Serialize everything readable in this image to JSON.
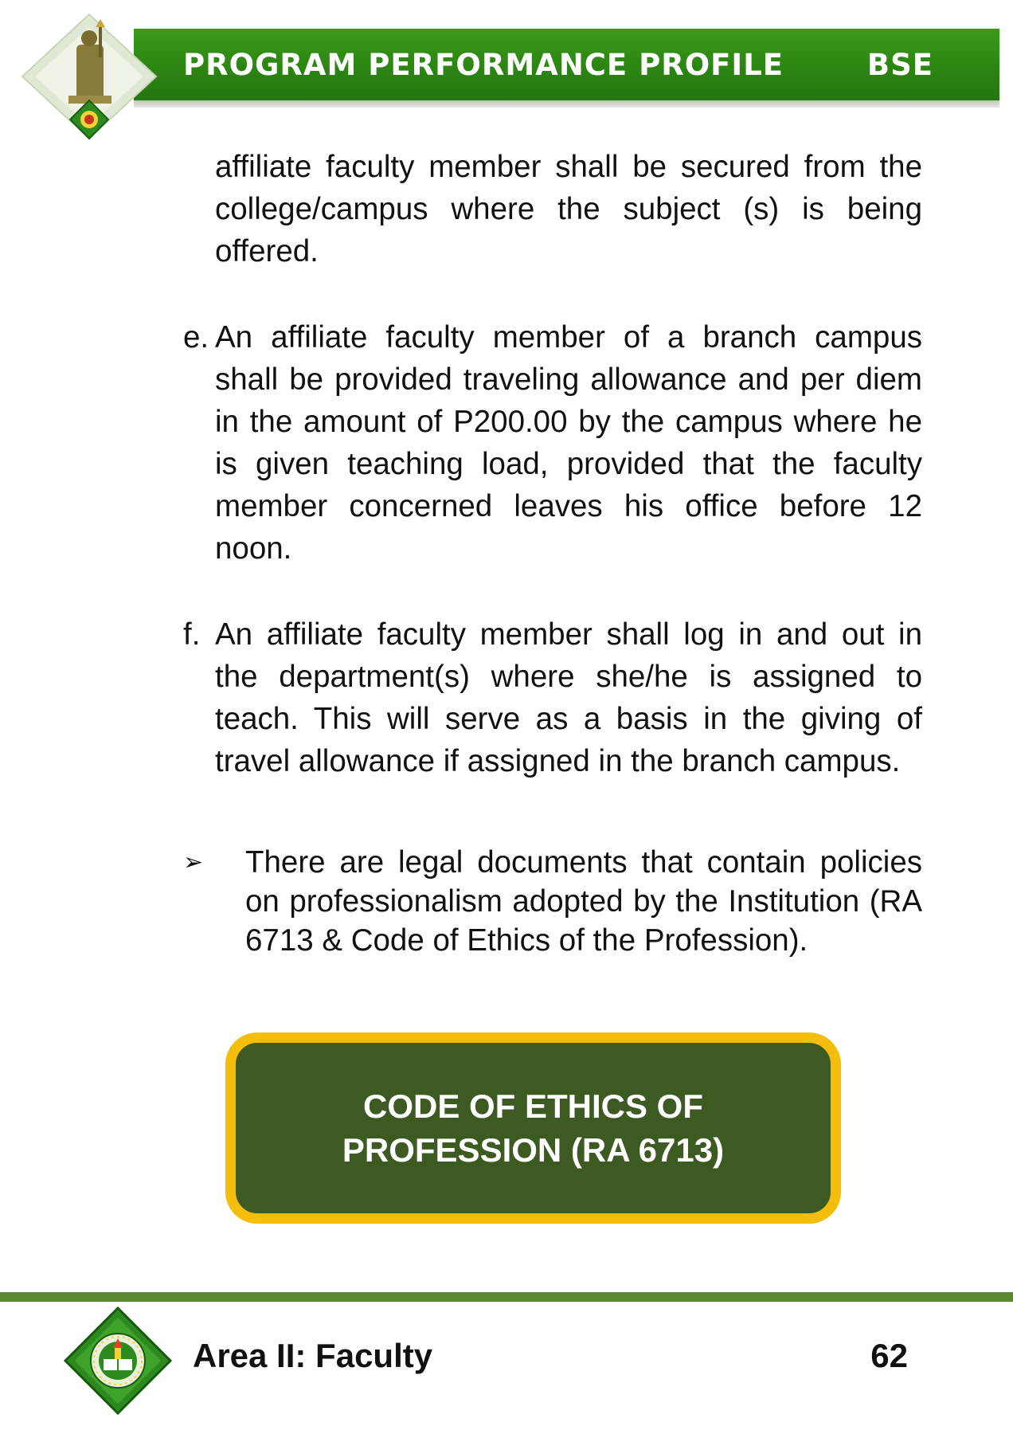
{
  "header": {
    "title": "PROGRAM PERFORMANCE PROFILE",
    "program_code": "BSE"
  },
  "content": {
    "continuation": "affiliate faculty member shall be secured from the college/campus where the subject (s) is being offered.",
    "items": [
      {
        "marker": "e.",
        "text": "An affiliate faculty member of a branch campus shall be provided traveling allowance and per diem in the amount of P200.00 by the campus where he is given teaching load, provided that the faculty member concerned leaves his office before 12 noon."
      },
      {
        "marker": "f.",
        "text": "An affiliate faculty member shall log in and out in the department(s) where she/he is assigned to teach. This will serve as a basis in the giving of travel allowance if assigned in the branch campus."
      }
    ],
    "bullet": {
      "symbol": "➢",
      "text": "There are legal documents that contain policies on professionalism adopted by the Institution (RA 6713 & Code of Ethics of the Profession)."
    }
  },
  "callout": {
    "line1": "CODE OF ETHICS OF",
    "line2": "PROFESSION (RA 6713)"
  },
  "footer": {
    "area": "Area II: Faculty",
    "page_number": "62"
  },
  "colors": {
    "header_green": "#2c8512",
    "callout_fill": "#3d5a22",
    "callout_border": "#f5bd0c",
    "footer_line": "#5b8a33"
  },
  "icons": {
    "header_emblem": "university-statue-emblem-icon",
    "footer_logo": "university-seal-icon"
  }
}
